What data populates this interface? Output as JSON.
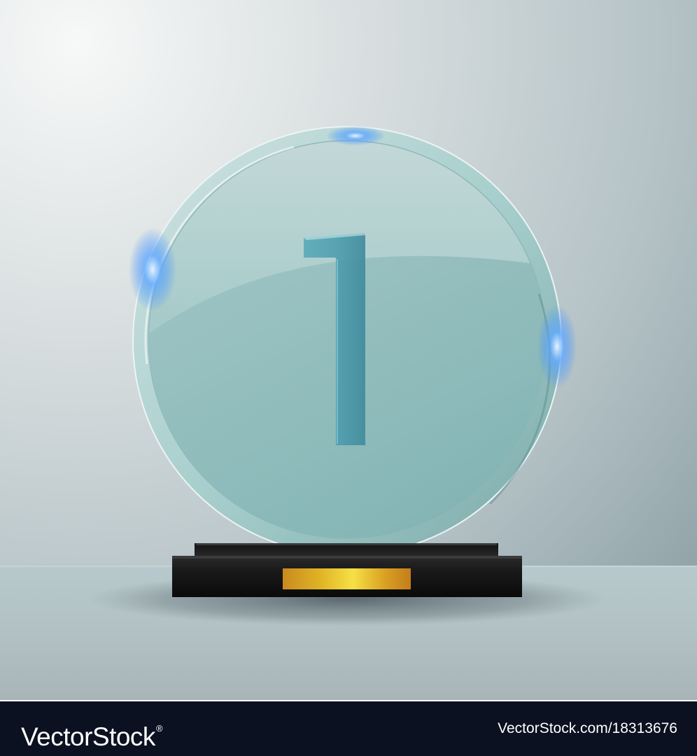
{
  "award": {
    "numeral": "1",
    "glass_color": "#9cc8c6",
    "base_color": "#141414",
    "plaque_color": "#d4a820"
  },
  "watermark": {
    "brand": "VectorStock",
    "registered_mark": "®",
    "image_id": "VectorStock.com/18313676"
  },
  "colors": {
    "background": "#c7d3d6",
    "footer": "#0b1120"
  }
}
